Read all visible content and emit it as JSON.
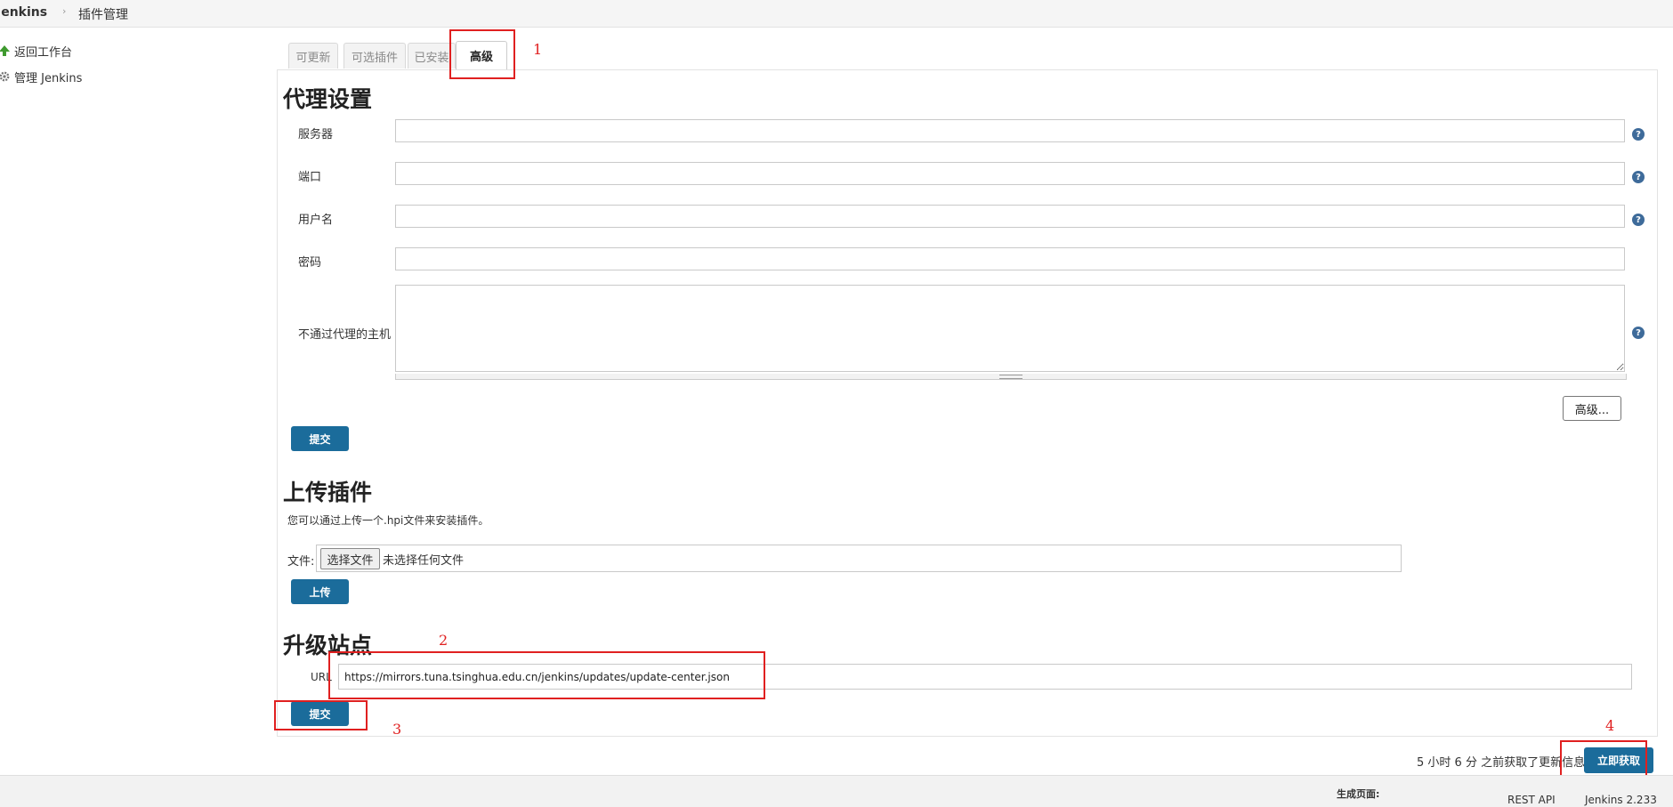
{
  "header": {
    "brand": "Jenkins",
    "separator": "›",
    "crumb": "插件管理"
  },
  "sidebar": {
    "items": [
      {
        "label": "返回工作台",
        "icon": "up-arrow-icon"
      },
      {
        "label": "管理 Jenkins",
        "icon": "gear-icon"
      }
    ]
  },
  "tabs": [
    {
      "label": "可更新",
      "active": false
    },
    {
      "label": "可选插件",
      "active": false
    },
    {
      "label": "已安装",
      "active": false
    },
    {
      "label": "高级",
      "active": true
    }
  ],
  "proxy": {
    "title": "代理设置",
    "server_label": "服务器",
    "server_value": "",
    "port_label": "端口",
    "port_value": "",
    "username_label": "用户名",
    "username_value": "",
    "password_label": "密码",
    "password_value": "",
    "no_proxy_label": "不通过代理的主机",
    "no_proxy_value": "",
    "advanced_button": "高级...",
    "submit_button": "提交"
  },
  "upload": {
    "title": "上传插件",
    "description": "您可以通过上传一个.hpi文件来安装插件。",
    "file_label": "文件:",
    "choose_button": "选择文件",
    "no_file_text": "未选择任何文件",
    "upload_button": "上传"
  },
  "update_site": {
    "title": "升级站点",
    "url_label": "URL",
    "url_value": "https://mirrors.tuna.tsinghua.edu.cn/jenkins/updates/update-center.json",
    "submit_button": "提交"
  },
  "status": {
    "last_fetched": "5 小时 6 分 之前获取了更新信息",
    "fetch_now_button": "立即获取"
  },
  "annotations": [
    "1",
    "2",
    "3",
    "4"
  ],
  "footer": {
    "generated_label": "生成页面:",
    "rest_api": "REST API",
    "version": "Jenkins 2.233"
  },
  "colors": {
    "primary_button": "#1b6c9b",
    "annotation_red": "#e02020",
    "help_icon": "#3e6b9a"
  }
}
